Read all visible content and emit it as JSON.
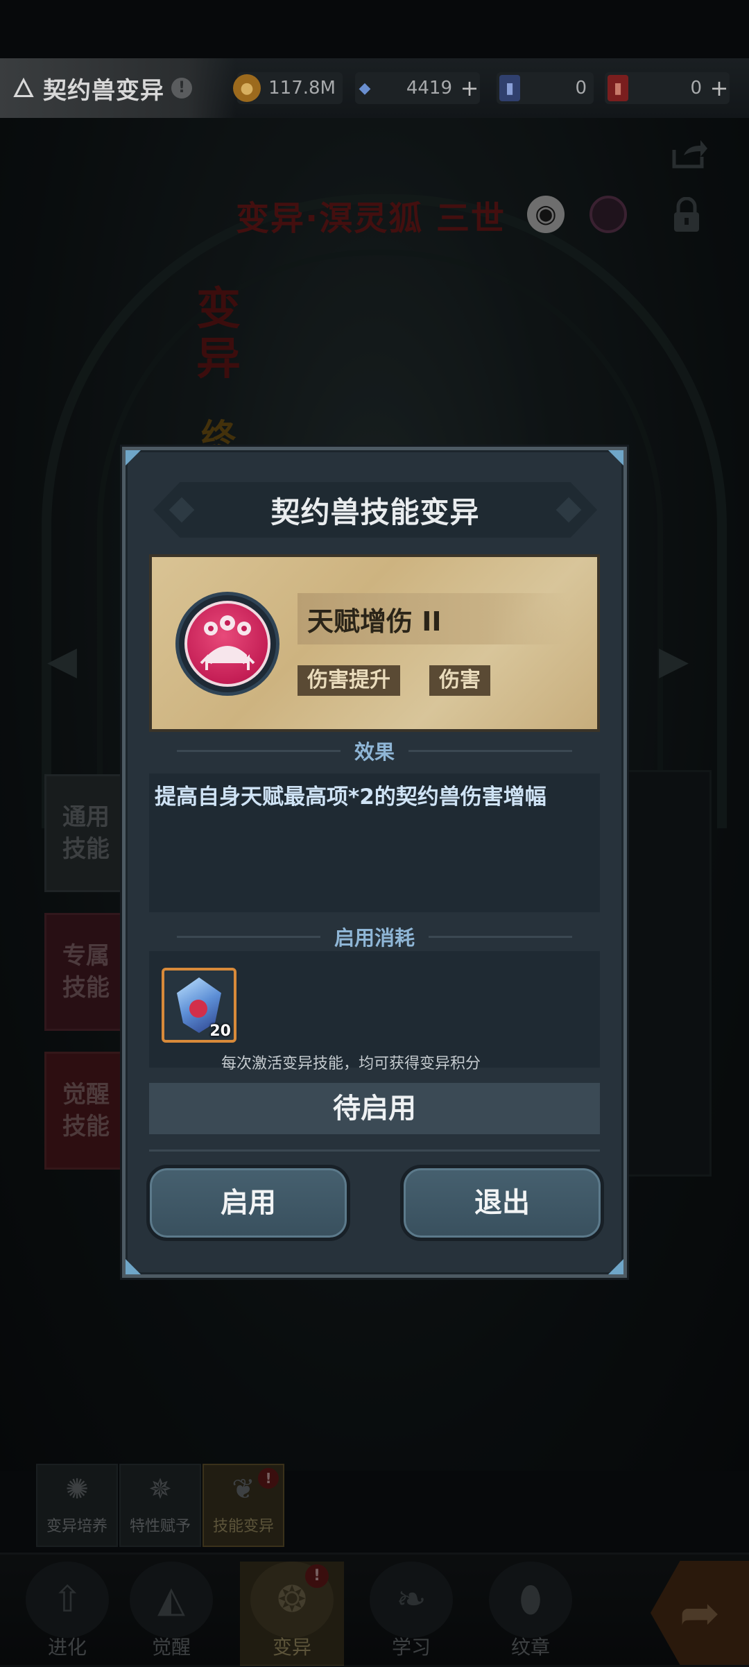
{
  "topbar": {
    "title": "契约兽变异",
    "info_glyph": "!",
    "resources": [
      {
        "name": "gold",
        "value": "117.8M",
        "has_plus": false,
        "color": "#9c6a1d"
      },
      {
        "name": "crystal",
        "value": "4419",
        "has_plus": true,
        "color": "#3d5fa8"
      },
      {
        "name": "blue-card",
        "value": "0",
        "has_plus": false,
        "color": "#30406e"
      },
      {
        "name": "red-card",
        "value": "0",
        "has_plus": true,
        "color": "#7a1e1e"
      }
    ],
    "plus_glyph": "+"
  },
  "scene": {
    "mutation_name": "变异·溟灵狐 三世",
    "vertical_label": "变异",
    "vertical_label2": "终",
    "side_tabs": [
      {
        "label": "通用\n技能"
      },
      {
        "label": "专属\n技能"
      },
      {
        "label": "觉醒\n技能"
      }
    ]
  },
  "dialog": {
    "title": "契约兽技能变异",
    "skill": {
      "name": "天赋增伤 II",
      "tags": [
        "伤害提升",
        "伤害"
      ]
    },
    "effect_section": "效果",
    "effect_text": "提高自身天赋最高项*2的契约兽伤害增幅",
    "cost_section": "启用消耗",
    "cost_item_count": "20",
    "hint": "每次激活变异技能，均可获得变异积分",
    "status": "待启用",
    "buttons": {
      "enable": "启用",
      "exit": "退出"
    }
  },
  "subtabs": [
    {
      "label": "变异培养",
      "active": false,
      "badge": ""
    },
    {
      "label": "特性赋予",
      "active": false,
      "badge": ""
    },
    {
      "label": "技能变异",
      "active": true,
      "badge": "!"
    }
  ],
  "navbar": [
    {
      "label": "进化",
      "active": false,
      "badge": ""
    },
    {
      "label": "觉醒",
      "active": false,
      "badge": ""
    },
    {
      "label": "变异",
      "active": true,
      "badge": "!"
    },
    {
      "label": "学习",
      "active": false,
      "badge": ""
    },
    {
      "label": "纹章",
      "active": false,
      "badge": ""
    }
  ],
  "icons": [
    "flame-icon",
    "gold-coin-icon",
    "crystal-icon",
    "blue-card-icon",
    "red-card-icon",
    "share-icon",
    "eye-icon",
    "moon-icon",
    "lock-icon",
    "arrow-left-icon",
    "arrow-right-icon",
    "paw-up-icon",
    "crystal-gem-icon"
  ]
}
